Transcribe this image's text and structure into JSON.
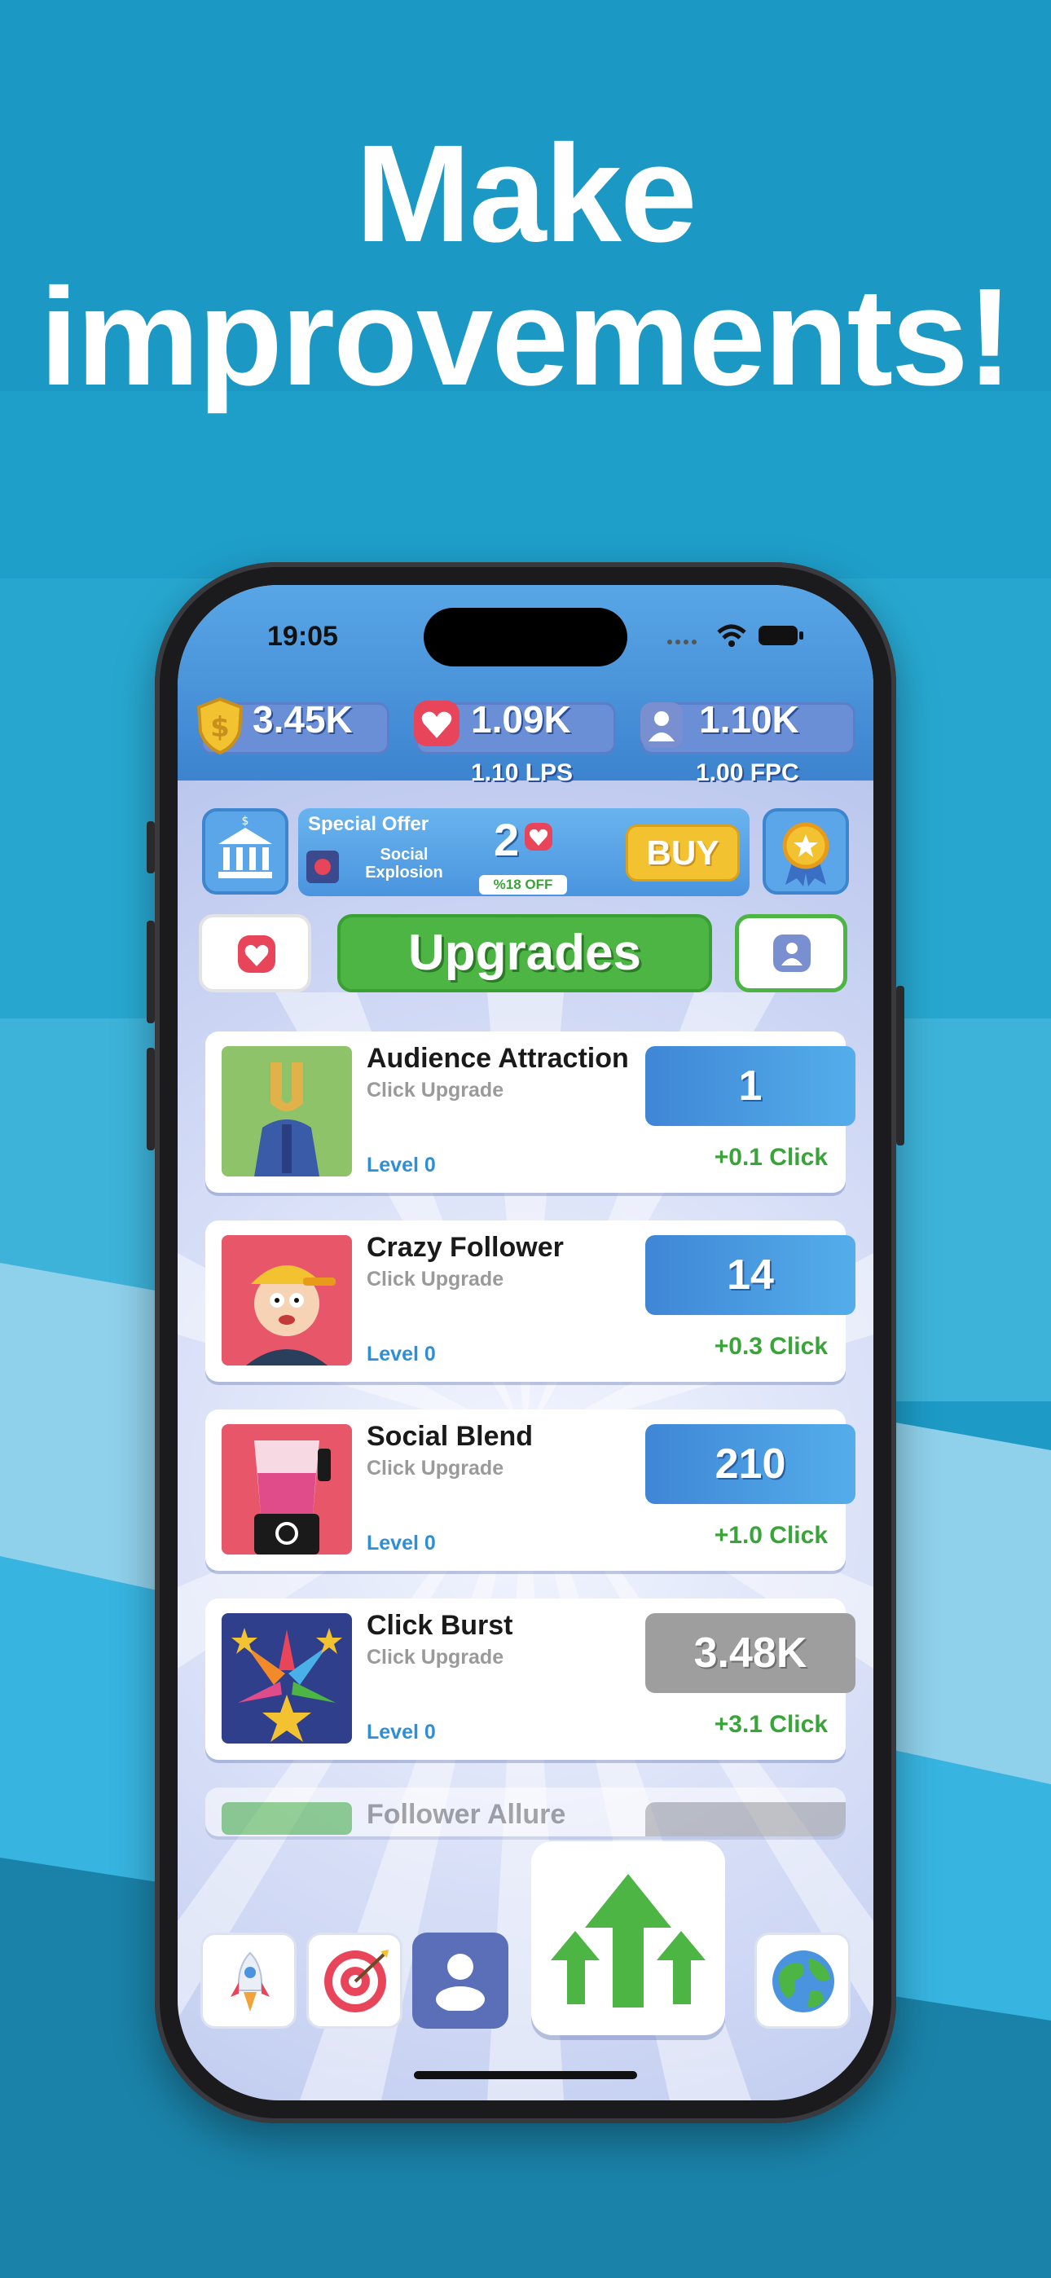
{
  "headline": {
    "line1": "Make",
    "line2": "improvements!"
  },
  "status_bar": {
    "time": "19:05"
  },
  "stats": {
    "coins": "3.45K",
    "likes": "1.09K",
    "followers": "1.10K",
    "lps": "1.10 LPS",
    "fpc": "1.00 FPC"
  },
  "offer": {
    "title": "Special Offer",
    "item_name_1": "Social",
    "item_name_2": "Explosion",
    "amount": "2",
    "discount": "%18 OFF",
    "buy_label": "BUY"
  },
  "section_title": "Upgrades",
  "upgrades": [
    {
      "name": "Audience Attraction",
      "type": "Click Upgrade",
      "level": "Level 0",
      "price": "1",
      "gain": "+0.1  Click"
    },
    {
      "name": "Crazy Follower",
      "type": "Click Upgrade",
      "level": "Level 0",
      "price": "14",
      "gain": "+0.3  Click"
    },
    {
      "name": "Social Blend",
      "type": "Click Upgrade",
      "level": "Level 0",
      "price": "210",
      "gain": "+1.0  Click"
    },
    {
      "name": "Click Burst",
      "type": "Click Upgrade",
      "level": "Level 0",
      "price": "3.48K",
      "gain": "+3.1  Click"
    },
    {
      "name": "Follower Allure"
    }
  ],
  "colors": {
    "accent_blue": "#3f86d6",
    "green": "#4cb544",
    "heart_red": "#e8455a",
    "gold": "#f2c230"
  },
  "icons": [
    "coin-icon",
    "heart-icon",
    "user-icon",
    "bank-icon",
    "ribbon-icon",
    "rocket-icon",
    "target-icon",
    "arrows-up-icon",
    "globe-icon"
  ]
}
